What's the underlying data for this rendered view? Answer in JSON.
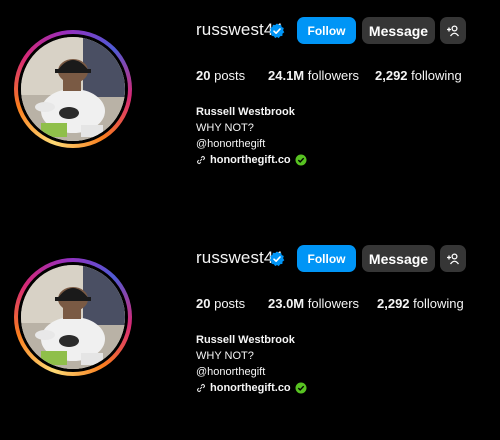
{
  "profiles": [
    {
      "username": "russwest44",
      "follow_label": "Follow",
      "message_label": "Message",
      "posts_count": "20",
      "posts_label": "posts",
      "followers_count": "24.1M",
      "followers_label": "followers",
      "following_count": "2,292",
      "following_label": "following",
      "full_name": "Russell Westbrook",
      "bio_line": "WHY NOT?",
      "handle": "@honorthegift",
      "link": "honorthegift.co"
    },
    {
      "username": "russwest44",
      "follow_label": "Follow",
      "message_label": "Message",
      "posts_count": "20",
      "posts_label": "posts",
      "followers_count": "23.0M",
      "followers_label": "followers",
      "following_count": "2,292",
      "following_label": "following",
      "full_name": "Russell Westbrook",
      "bio_line": "WHY NOT?",
      "handle": "@honorthegift",
      "link": "honorthegift.co"
    }
  ],
  "colors": {
    "background": "#000000",
    "follow_button": "#0095f6",
    "secondary_button": "#363636",
    "verified_badge": "#0095f6",
    "link_check": "#58c322"
  },
  "icons": {
    "verified": "verified-badge-icon",
    "add_person": "add-person-icon",
    "link": "link-icon"
  }
}
